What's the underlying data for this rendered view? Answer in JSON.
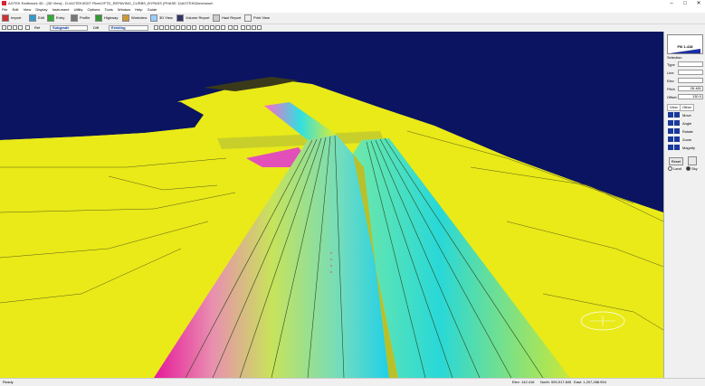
{
  "window": {
    "title": "AGTEK Earthwork 4D - [3D View] - D:\\AGTEK\\EDIT Files\\OFTD_REPAVING_CURBS_BYPASS (PHASE 1)\\AGTEK\\Dimension\\",
    "minimize": "–",
    "maximize": "□",
    "close": "✕"
  },
  "menu": [
    "File",
    "Edit",
    "View",
    "Display",
    "Instrument",
    "Utility",
    "Options",
    "Tools",
    "Window",
    "Help",
    "Guide"
  ],
  "toolbar": {
    "items": [
      "Import",
      "Edit",
      "Entry",
      "Profile",
      "Highway",
      "Workview",
      "3D View",
      "Volume Report",
      "Haul Report",
      "Print View"
    ]
  },
  "toolbar2": {
    "ref_label": "Ref",
    "ref_value": "Subgrade",
    "diff_label": "Diff",
    "diff_value": "Existing"
  },
  "side": {
    "fill_label": "Fill 1.418",
    "selection_label": "Selection",
    "fields": [
      {
        "label": "Type",
        "value": ""
      },
      {
        "label": "Line",
        "value": ""
      },
      {
        "label": "Elev",
        "value": ""
      },
      {
        "label": "Pitch",
        "value": "26.481"
      },
      {
        "label": "Offset",
        "value": "130.0"
      }
    ],
    "tabs": [
      "View",
      "Other"
    ],
    "nav": [
      "Move",
      "Angle",
      "Rotate",
      "Zoom",
      "Magnify"
    ],
    "reset_label": "Reset",
    "radio_land": "Land",
    "radio_sky": "Sky"
  },
  "status": {
    "ready": "Ready",
    "elev": "Elev: 142.416",
    "north": "North: 590,917.845",
    "east": "East: 1,207,288.994"
  },
  "colors": {
    "sky": "#0b1460",
    "ground": "#e9ea18",
    "water": "#0b1460"
  }
}
